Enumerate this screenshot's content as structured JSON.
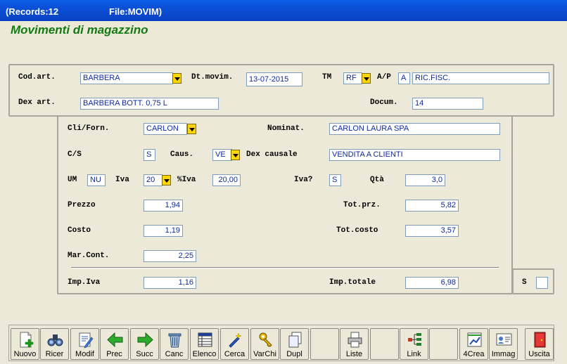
{
  "window": {
    "records": "(Records:12",
    "file": "File:MOVIM)"
  },
  "form_title": "Movimenti di magazzino",
  "top_panel": {
    "cod_art": {
      "label": "Cod.art.",
      "value": "BARBERA"
    },
    "dt_movim": {
      "label": "Dt.movim.",
      "value": "13-07-2015"
    },
    "tm": {
      "label": "TM",
      "value": "RF"
    },
    "ap": {
      "label": "A/P",
      "value": "A"
    },
    "ap_desc": {
      "value": "RIC.FISC."
    },
    "dex_art": {
      "label": "Dex art.",
      "value": "BARBERA BOTT. 0,75 L"
    },
    "docum": {
      "label": "Docum.",
      "value": "14"
    }
  },
  "main_panel": {
    "cli_forn": {
      "label": "Cli/Forn.",
      "value": "CARLON"
    },
    "nominat": {
      "label": "Nominat.",
      "value": "CARLON LAURA SPA"
    },
    "cs": {
      "label": "C/S",
      "value": "S"
    },
    "caus": {
      "label": "Caus.",
      "value": "VE"
    },
    "dex_causale": {
      "label": "Dex causale",
      "value": "VENDITA A CLIENTI"
    },
    "um": {
      "label": "UM",
      "value": "NU"
    },
    "iva": {
      "label": "Iva",
      "value": "20"
    },
    "perc_iva": {
      "label": "%Iva",
      "value": "20,00"
    },
    "iva_q": {
      "label": "Iva?",
      "value": "S"
    },
    "qta": {
      "label": "Qtà",
      "value": "3,0"
    },
    "prezzo": {
      "label": "Prezzo",
      "value": "1,94"
    },
    "tot_prz": {
      "label": "Tot.prz.",
      "value": "5,82"
    },
    "costo": {
      "label": "Costo",
      "value": "1,19"
    },
    "tot_costo": {
      "label": "Tot.costo",
      "value": "3,57"
    },
    "mar_cont": {
      "label": "Mar.Cont.",
      "value": "2,25"
    },
    "imp_iva": {
      "label": "Imp.Iva",
      "value": "1,16"
    },
    "imp_totale": {
      "label": "Imp.totale",
      "value": "6,98"
    }
  },
  "side": {
    "s_label": "S",
    "s_value": ""
  },
  "toolbar": {
    "nuovo": "Nuovo",
    "ricer": "Ricer",
    "modif": "Modif",
    "prec": "Prec",
    "succ": "Succ",
    "canc": "Canc",
    "elenco": "Elenco",
    "cerca": "Cerca",
    "varchi": "VarChi",
    "dupl": "Dupl",
    "liste": "Liste",
    "link": "Link",
    "crea4": "4Crea",
    "immag": "Immag",
    "uscita": "Uscita"
  }
}
